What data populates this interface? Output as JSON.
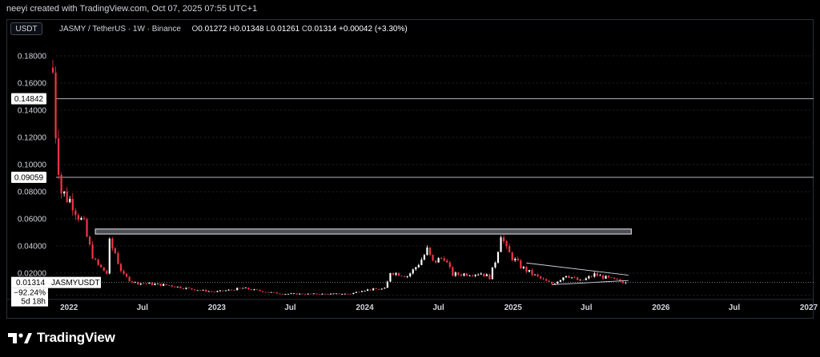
{
  "header": {
    "credit": "neeyi created with TradingView.com, Oct 07, 2025 07:55 UTC+1"
  },
  "toolbar": {
    "currency": "USDT",
    "symbol_desc": "JASMY / TetherUS · 1W · Binance",
    "o_label": "O",
    "o_value": "0.01272",
    "h_label": "H",
    "h_value": "0.01348",
    "l_label": "L",
    "l_value": "0.01261",
    "c_label": "C",
    "c_value": "0.01314",
    "change": "+0.00042 (+3.30%)"
  },
  "price_badge": {
    "price": "0.01314",
    "symbol": "JASMYUSDT",
    "change_pct": "−92.24%",
    "countdown": "5d 18h"
  },
  "brand": {
    "name": "TradingView"
  },
  "colors": {
    "up": "#ffffff",
    "down": "#f23645",
    "grid": "#1e222d",
    "axis_text": "#d1d4dc",
    "level_line": "#b2b5be",
    "zone_fill": "#4d4f55"
  },
  "chart_data": {
    "type": "candlestick",
    "xlabel": "",
    "ylabel": "",
    "x_range": [
      "2021-11-22",
      "2027-01-01"
    ],
    "ylim": [
      0.0,
      0.19
    ],
    "y_ticks": [
      "0.18000",
      "0.16000",
      "0.14000",
      "0.12000",
      "0.10000",
      "0.08000",
      "0.06000",
      "0.04000",
      "0.02000"
    ],
    "x_ticks": [
      {
        "label": "2022",
        "date": "2022-01-01"
      },
      {
        "label": "Jul",
        "date": "2022-07-01"
      },
      {
        "label": "2023",
        "date": "2023-01-01"
      },
      {
        "label": "Jul",
        "date": "2023-07-01"
      },
      {
        "label": "2024",
        "date": "2024-01-01"
      },
      {
        "label": "Jul",
        "date": "2024-07-01"
      },
      {
        "label": "2025",
        "date": "2025-01-01"
      },
      {
        "label": "Jul",
        "date": "2025-07-01"
      },
      {
        "label": "2026",
        "date": "2026-01-01"
      },
      {
        "label": "Jul",
        "date": "2026-07-01"
      },
      {
        "label": "2027",
        "date": "2027-01-01"
      }
    ],
    "horizontal_levels": [
      {
        "label": "0.14842",
        "value": 0.14842
      },
      {
        "label": "0.09059",
        "value": 0.09059
      }
    ],
    "resistance_zone": {
      "start": "2022-03-07",
      "end": "2025-10-20",
      "low": 0.0488,
      "high": 0.0525
    },
    "triangle": {
      "upper": [
        [
          "2025-02-03",
          0.0275
        ],
        [
          "2025-10-13",
          0.0185
        ]
      ],
      "lower": [
        [
          "2025-04-07",
          0.0115
        ],
        [
          "2025-10-13",
          0.0146
        ]
      ]
    },
    "key_points": [
      [
        "2021-11-22",
        0.168
      ],
      [
        "2021-11-29",
        0.125
      ],
      [
        "2021-12-13",
        0.08
      ],
      [
        "2022-01-10",
        0.072
      ],
      [
        "2022-02-07",
        0.055
      ],
      [
        "2022-03-07",
        0.028
      ],
      [
        "2022-04-04",
        0.02
      ],
      [
        "2022-04-11",
        0.042
      ],
      [
        "2022-04-25",
        0.035
      ],
      [
        "2022-05-16",
        0.018
      ],
      [
        "2022-06-13",
        0.013
      ],
      [
        "2022-09-05",
        0.011
      ],
      [
        "2022-12-26",
        0.0062
      ],
      [
        "2023-03-06",
        0.009
      ],
      [
        "2023-06-12",
        0.0048
      ],
      [
        "2023-09-11",
        0.0046
      ],
      [
        "2023-11-27",
        0.0048
      ],
      [
        "2023-12-25",
        0.0075
      ],
      [
        "2024-02-19",
        0.0085
      ],
      [
        "2024-03-04",
        0.021
      ],
      [
        "2024-04-15",
        0.018
      ],
      [
        "2024-06-03",
        0.037
      ],
      [
        "2024-06-17",
        0.028
      ],
      [
        "2024-07-15",
        0.032
      ],
      [
        "2024-08-05",
        0.019
      ],
      [
        "2024-10-14",
        0.02
      ],
      [
        "2024-11-04",
        0.017
      ],
      [
        "2024-12-02",
        0.05
      ],
      [
        "2024-12-16",
        0.037
      ],
      [
        "2025-01-20",
        0.025
      ],
      [
        "2025-03-10",
        0.016
      ],
      [
        "2025-04-07",
        0.012
      ],
      [
        "2025-05-12",
        0.019
      ],
      [
        "2025-06-16",
        0.014
      ],
      [
        "2025-07-21",
        0.019
      ],
      [
        "2025-10-06",
        0.01314
      ]
    ],
    "last_close": 0.01314
  }
}
